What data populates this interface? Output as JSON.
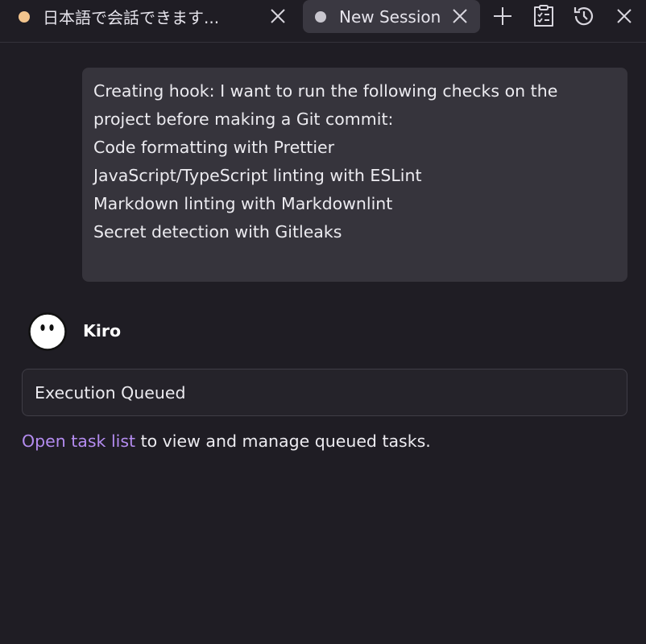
{
  "tabs": [
    {
      "label": "日本語で会話できます...",
      "dot_color": "#f2c48d",
      "active": false,
      "close_icon": "close-icon"
    },
    {
      "label": "New Session",
      "dot_color": "#c8c6ce",
      "active": true,
      "close_icon": "close-icon"
    }
  ],
  "toolbar": {
    "icons": [
      "plus-icon",
      "task-list-icon",
      "history-icon",
      "close-icon"
    ]
  },
  "message": {
    "lines": [
      "Creating hook: I want to run the following checks on the",
      "project before making a Git commit:",
      "Code formatting with Prettier",
      "JavaScript/TypeScript linting with ESLint",
      "Markdown linting with Markdownlint",
      "Secret detection with Gitleaks"
    ]
  },
  "agent": {
    "name": "Kiro",
    "avatar_icon": "ghost-avatar-icon"
  },
  "status": {
    "text": "Execution Queued"
  },
  "info": {
    "link_text": "Open task list",
    "rest_text": " to view and manage queued tasks."
  },
  "colors": {
    "background": "#1f1d24",
    "message_bg": "#36343c",
    "link": "#b48cf0"
  }
}
